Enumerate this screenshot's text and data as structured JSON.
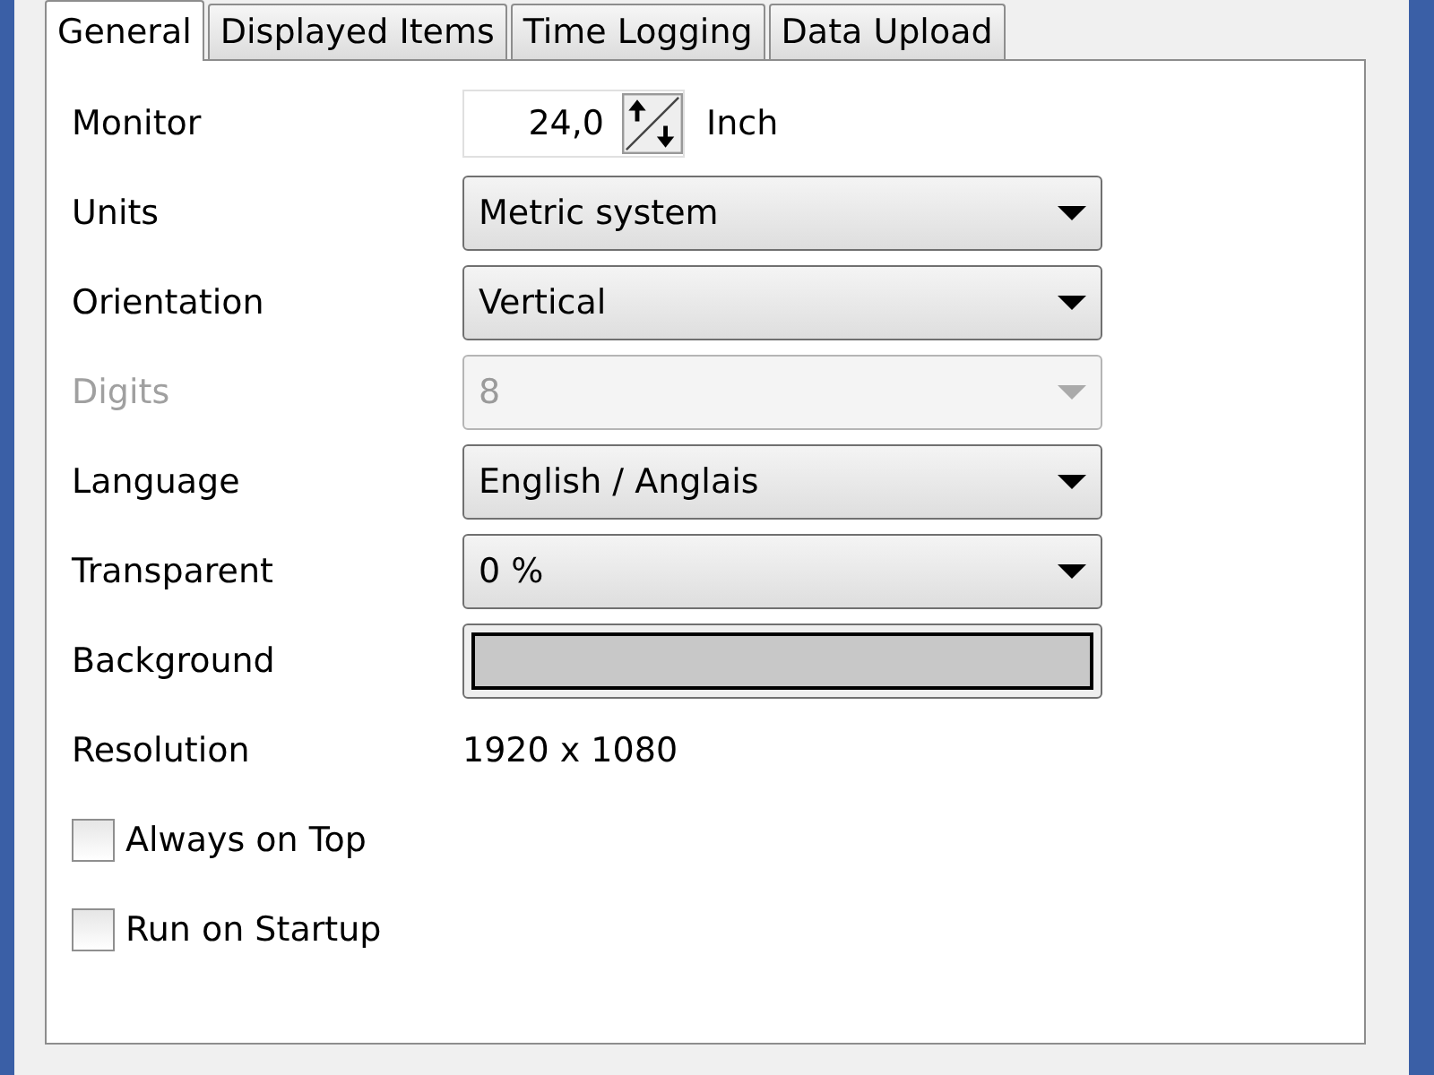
{
  "tabs": [
    {
      "label": "General",
      "selected": true
    },
    {
      "label": "Displayed Items",
      "selected": false
    },
    {
      "label": "Time Logging",
      "selected": false
    },
    {
      "label": "Data Upload",
      "selected": false
    }
  ],
  "settings": [
    {
      "kind": "spinner",
      "label": "Monitor",
      "value": "24,0",
      "unit": "Inch",
      "disabled": false
    },
    {
      "kind": "dropdown",
      "label": "Units",
      "value": "Metric system",
      "disabled": false
    },
    {
      "kind": "dropdown",
      "label": "Orientation",
      "value": "Vertical",
      "disabled": false
    },
    {
      "kind": "dropdown",
      "label": "Digits",
      "value": "8",
      "disabled": true
    },
    {
      "kind": "dropdown",
      "label": "Language",
      "value": "English / Anglais",
      "disabled": false
    },
    {
      "kind": "dropdown",
      "label": "Transparent",
      "value": "0 %",
      "disabled": false
    },
    {
      "kind": "color",
      "label": "Background",
      "color": "#c8c8c8",
      "disabled": false
    },
    {
      "kind": "text",
      "label": "Resolution",
      "value": "1920 x 1080",
      "disabled": false
    }
  ],
  "checkboxes": [
    {
      "label": "Always on Top",
      "checked": false
    },
    {
      "label": "Run on Startup",
      "checked": false
    }
  ]
}
